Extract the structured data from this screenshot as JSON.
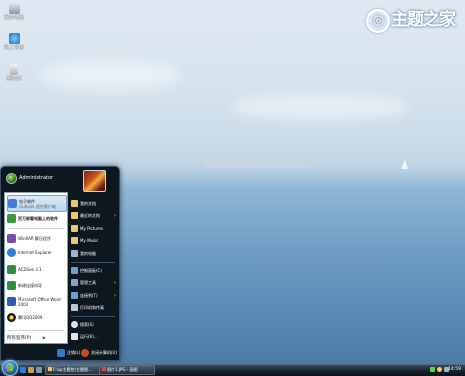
{
  "desktop": {
    "icons": [
      {
        "label": "我的电脑"
      },
      {
        "label": "网上邻居"
      },
      {
        "label": "回收站"
      }
    ],
    "logo_text": "主题之家"
  },
  "start_menu": {
    "user_name": "Administrator",
    "pinned": [
      {
        "title": "电子邮件",
        "subtitle": "Outlook 速件客户端",
        "color": "#3d7fd2"
      },
      {
        "title": "百万卸载电脑上的软件",
        "subtitle": "",
        "color": "#3a9a3a"
      }
    ],
    "recent": [
      {
        "title": "WinRAR 解压程序",
        "color": "#7a4ea2"
      },
      {
        "title": "Internet Explorer",
        "color": "#2e7fd8"
      },
      {
        "title": "ACDSee 3.1",
        "color": "#2e8e3e"
      },
      {
        "title": "新建连接向导",
        "color": "#2e8e3e"
      },
      {
        "title": "Microsoft Office Word 2003",
        "color": "#2a5db0"
      },
      {
        "title": "腾讯QQ2009",
        "color": "#1a1a1a"
      }
    ],
    "all_programs": "所有程序(P)",
    "right_items": [
      {
        "label": "我的文档",
        "arrow": false,
        "color": "#e8c96b"
      },
      {
        "label": "最近的文档",
        "arrow": true,
        "color": "#e8c96b"
      },
      {
        "label": "My Pictures",
        "arrow": false,
        "color": "#e8c96b"
      },
      {
        "label": "My Music",
        "arrow": false,
        "color": "#e8c96b"
      },
      {
        "label": "我的电脑",
        "arrow": false,
        "color": "#9fb4c8"
      },
      {
        "label": "控制面板(C)",
        "arrow": false,
        "color": "#6aa0d8"
      },
      {
        "label": "管理工具",
        "arrow": true,
        "color": "#8aa0b6"
      },
      {
        "label": "连接到(T)",
        "arrow": true,
        "color": "#6aa0d8"
      },
      {
        "label": "打印机和传真",
        "arrow": false,
        "color": "#bfc7cf"
      },
      {
        "label": "搜索(S)",
        "arrow": false,
        "color": "#e0e6ec"
      },
      {
        "label": "运行(R)...",
        "arrow": false,
        "color": "#e0e6ec"
      }
    ],
    "logoff_label": "注销(L)",
    "shutdown_label": "关闭计算机(U)"
  },
  "taskbar": {
    "tasks": [
      "F:\\xp主题包\\主题图...",
      "图片1.JPG - 画图"
    ],
    "clock": "14:59"
  }
}
